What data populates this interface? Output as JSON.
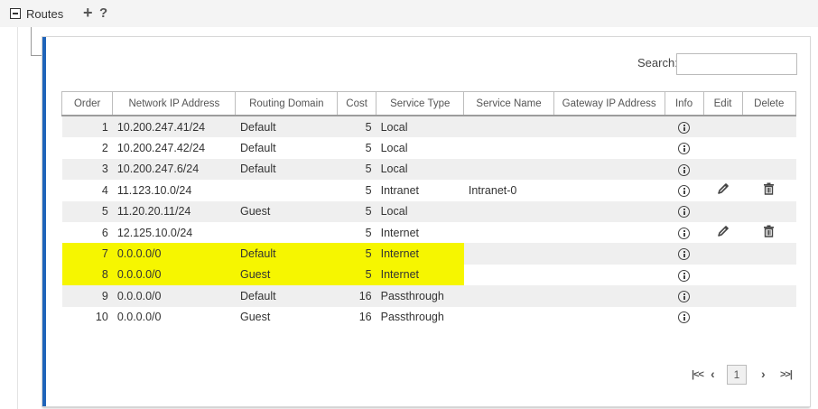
{
  "header": {
    "title": "Routes",
    "add_icon": "+",
    "help_icon": "?"
  },
  "search": {
    "label": "Search:",
    "value": "",
    "placeholder": ""
  },
  "table": {
    "columns": [
      "Order",
      "Network IP Address",
      "Routing Domain",
      "Cost",
      "Service Type",
      "Service Name",
      "Gateway IP Address",
      "Info",
      "Edit",
      "Delete"
    ],
    "rows": [
      {
        "order": "1",
        "network": "10.200.247.41/24",
        "domain": "Default",
        "cost": "5",
        "service_type": "Local",
        "service_name": "",
        "gateway": "",
        "editable": false,
        "highlighted": false
      },
      {
        "order": "2",
        "network": "10.200.247.42/24",
        "domain": "Default",
        "cost": "5",
        "service_type": "Local",
        "service_name": "",
        "gateway": "",
        "editable": false,
        "highlighted": false
      },
      {
        "order": "3",
        "network": "10.200.247.6/24",
        "domain": "Default",
        "cost": "5",
        "service_type": "Local",
        "service_name": "",
        "gateway": "",
        "editable": false,
        "highlighted": false
      },
      {
        "order": "4",
        "network": "11.123.10.0/24",
        "domain": "",
        "cost": "5",
        "service_type": "Intranet",
        "service_name": "Intranet-0",
        "gateway": "",
        "editable": true,
        "highlighted": false
      },
      {
        "order": "5",
        "network": "11.20.20.11/24",
        "domain": "Guest",
        "cost": "5",
        "service_type": "Local",
        "service_name": "",
        "gateway": "",
        "editable": false,
        "highlighted": false
      },
      {
        "order": "6",
        "network": "12.125.10.0/24",
        "domain": "",
        "cost": "5",
        "service_type": "Internet",
        "service_name": "",
        "gateway": "",
        "editable": true,
        "highlighted": false
      },
      {
        "order": "7",
        "network": "0.0.0.0/0",
        "domain": "Default",
        "cost": "5",
        "service_type": "Internet",
        "service_name": "",
        "gateway": "",
        "editable": false,
        "highlighted": true
      },
      {
        "order": "8",
        "network": "0.0.0.0/0",
        "domain": "Guest",
        "cost": "5",
        "service_type": "Internet",
        "service_name": "",
        "gateway": "",
        "editable": false,
        "highlighted": true
      },
      {
        "order": "9",
        "network": "0.0.0.0/0",
        "domain": "Default",
        "cost": "16",
        "service_type": "Passthrough",
        "service_name": "",
        "gateway": "",
        "editable": false,
        "highlighted": false
      },
      {
        "order": "10",
        "network": "0.0.0.0/0",
        "domain": "Guest",
        "cost": "16",
        "service_type": "Passthrough",
        "service_name": "",
        "gateway": "",
        "editable": false,
        "highlighted": false
      }
    ]
  },
  "pagination": {
    "first": "⏮",
    "prev": "‹",
    "current_page": "1",
    "next": "›",
    "last": "⏭"
  },
  "icons": {
    "info": "info-circle-icon",
    "edit": "pencil-icon",
    "delete": "trash-icon"
  },
  "colors": {
    "accent": "#1f64b9",
    "highlight": "#f6f600",
    "row_alt": "#efefef"
  }
}
